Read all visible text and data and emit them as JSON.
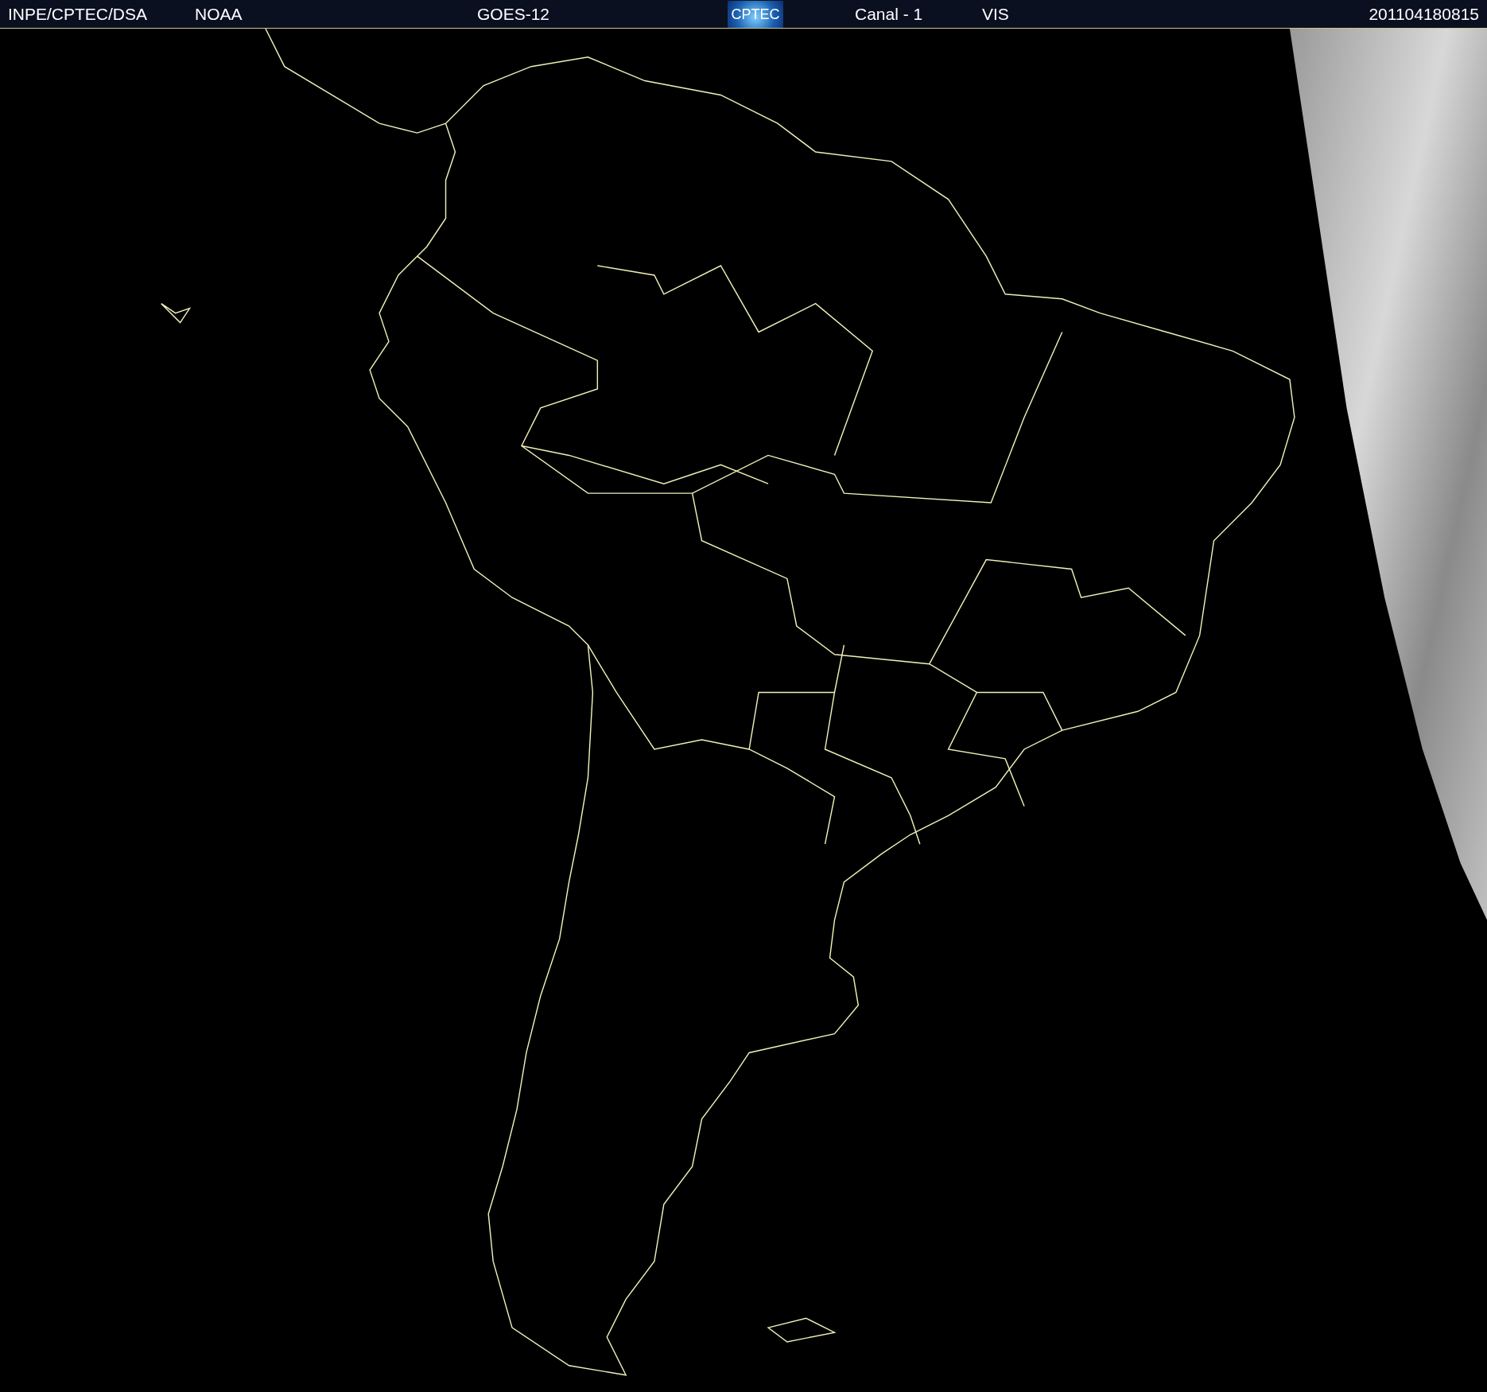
{
  "header": {
    "items": [
      {
        "kind": "text",
        "label": "INPE/CPTEC/DSA"
      },
      {
        "kind": "text",
        "label": "NOAA"
      },
      {
        "kind": "text",
        "label": "GOES-12"
      },
      {
        "kind": "logo",
        "label": "CPTEC"
      },
      {
        "kind": "text",
        "label": "Canal - 1"
      },
      {
        "kind": "text",
        "label": "VIS"
      },
      {
        "kind": "text",
        "label": "201104180815"
      }
    ]
  }
}
